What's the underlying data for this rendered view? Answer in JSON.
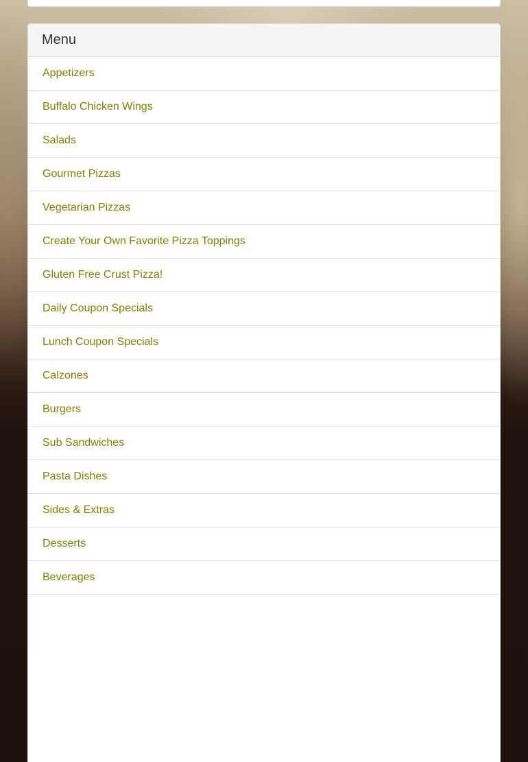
{
  "menu": {
    "heading": "Menu",
    "items": [
      {
        "label": "Appetizers"
      },
      {
        "label": "Buffalo Chicken Wings"
      },
      {
        "label": "Salads"
      },
      {
        "label": "Gourmet Pizzas"
      },
      {
        "label": "Vegetarian Pizzas"
      },
      {
        "label": "Create Your Own Favorite Pizza Toppings"
      },
      {
        "label": "Gluten Free Crust Pizza!"
      },
      {
        "label": "Daily Coupon Specials"
      },
      {
        "label": "Lunch Coupon Specials"
      },
      {
        "label": "Calzones"
      },
      {
        "label": "Burgers"
      },
      {
        "label": "Sub Sandwiches"
      },
      {
        "label": "Pasta Dishes"
      },
      {
        "label": "Sides & Extras"
      },
      {
        "label": "Desserts"
      },
      {
        "label": "Beverages"
      }
    ]
  },
  "colors": {
    "link": "#808000",
    "heading_bg": "#f5f5f5",
    "border": "#dddddd"
  }
}
